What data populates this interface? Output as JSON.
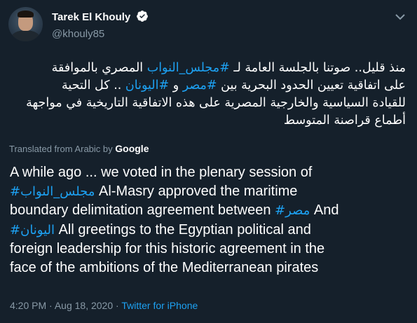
{
  "author": {
    "display_name": "Tarek El Khouly",
    "handle": "@khouly85",
    "verified": true
  },
  "tweet": {
    "arabic_lines": [
      [
        {
          "t": "منذ قليل.. صوتنا بالجلسة العامة لـ "
        },
        {
          "t": "#مجلس_النواب",
          "h": true
        },
        {
          "t": " المصري بالموافقة"
        }
      ],
      [
        {
          "t": "على اتفاقية تعيين الحدود البحرية بين "
        },
        {
          "t": "#مصر",
          "h": true
        },
        {
          "t": " و "
        },
        {
          "t": "#اليونان",
          "h": true
        },
        {
          "t": " .. كل التحية"
        }
      ],
      [
        {
          "t": "للقيادة السياسية والخارجية المصرية على هذه الاتفاقية التاريخية في مواجهة"
        }
      ],
      [
        {
          "t": "أطماع قراصنة المتوسط"
        }
      ]
    ],
    "translated_label": "Translated from Arabic by",
    "translator": "Google",
    "english_lines": [
      [
        {
          "t": "A while ago ... we voted in the plenary session of"
        }
      ],
      [
        {
          "t": "#مجلس_النواب",
          "h": true
        },
        {
          "t": " Al-Masry approved the maritime"
        }
      ],
      [
        {
          "t": "boundary delimitation agreement between "
        },
        {
          "t": "#مصر",
          "h": true
        },
        {
          "t": " And"
        }
      ],
      [
        {
          "t": "#اليونان",
          "h": true
        },
        {
          "t": " All greetings to the Egyptian political and"
        }
      ],
      [
        {
          "t": "foreign leadership for this historic agreement in the"
        }
      ],
      [
        {
          "t": "face of the ambitions of the Mediterranean pirates"
        }
      ]
    ],
    "time": "4:20 PM",
    "separator": "·",
    "date": "Aug 18, 2020",
    "source": "Twitter for iPhone"
  },
  "colors": {
    "background": "#15202b",
    "link": "#1da1f2",
    "secondary_text": "#8899a6",
    "primary_text": "#ffffff"
  },
  "icons": [
    "verified-badge-icon",
    "chevron-down-icon"
  ]
}
